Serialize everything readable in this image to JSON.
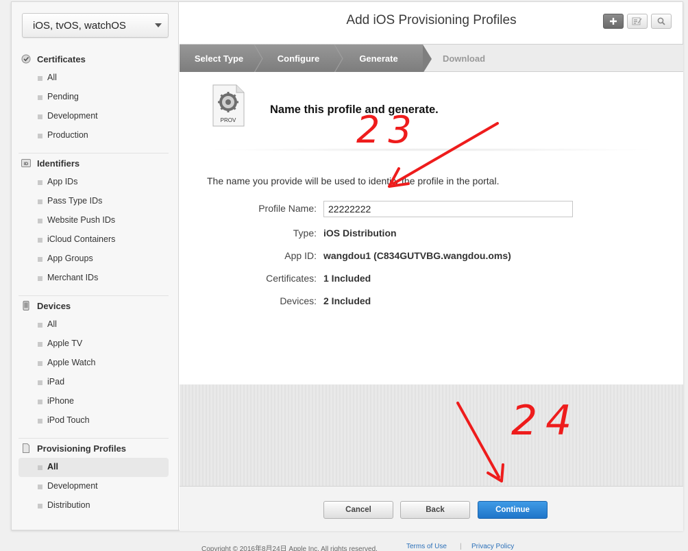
{
  "sidebar": {
    "platform": "iOS, tvOS, watchOS",
    "sections": [
      {
        "title": "Certificates",
        "items": [
          "All",
          "Pending",
          "Development",
          "Production"
        ]
      },
      {
        "title": "Identifiers",
        "items": [
          "App IDs",
          "Pass Type IDs",
          "Website Push IDs",
          "iCloud Containers",
          "App Groups",
          "Merchant IDs"
        ]
      },
      {
        "title": "Devices",
        "items": [
          "All",
          "Apple TV",
          "Apple Watch",
          "iPad",
          "iPhone",
          "iPod Touch"
        ]
      },
      {
        "title": "Provisioning Profiles",
        "items": [
          "All",
          "Development",
          "Distribution"
        ]
      }
    ],
    "id_icon_text": "ID"
  },
  "header": {
    "title": "Add iOS Provisioning Profiles"
  },
  "steps": [
    "Select Type",
    "Configure",
    "Generate",
    "Download"
  ],
  "content": {
    "icon_label": "PROV",
    "heading": "Name this profile and generate.",
    "intro": "The name you provide will be used to identify the profile in the portal.",
    "fields": {
      "profile_name_label": "Profile Name:",
      "profile_name_value": "22222222",
      "type_label": "Type:",
      "type_value": "iOS Distribution",
      "app_id_label": "App ID:",
      "app_id_value": "wangdou1 (C834GUTVBG.wangdou.oms)",
      "certificates_label": "Certificates:",
      "certificates_value": "1 Included",
      "devices_label": "Devices:",
      "devices_value": "2 Included"
    }
  },
  "buttons": {
    "cancel": "Cancel",
    "back": "Back",
    "continue": "Continue"
  },
  "footer": {
    "copyright": "Copyright © 2016年8月24日 Apple Inc. All rights reserved.",
    "terms": "Terms of Use",
    "separator": "|",
    "privacy": "Privacy Policy"
  },
  "annotations": {
    "label_23": "23",
    "label_24": "24",
    "color": "#ee1c1c"
  }
}
